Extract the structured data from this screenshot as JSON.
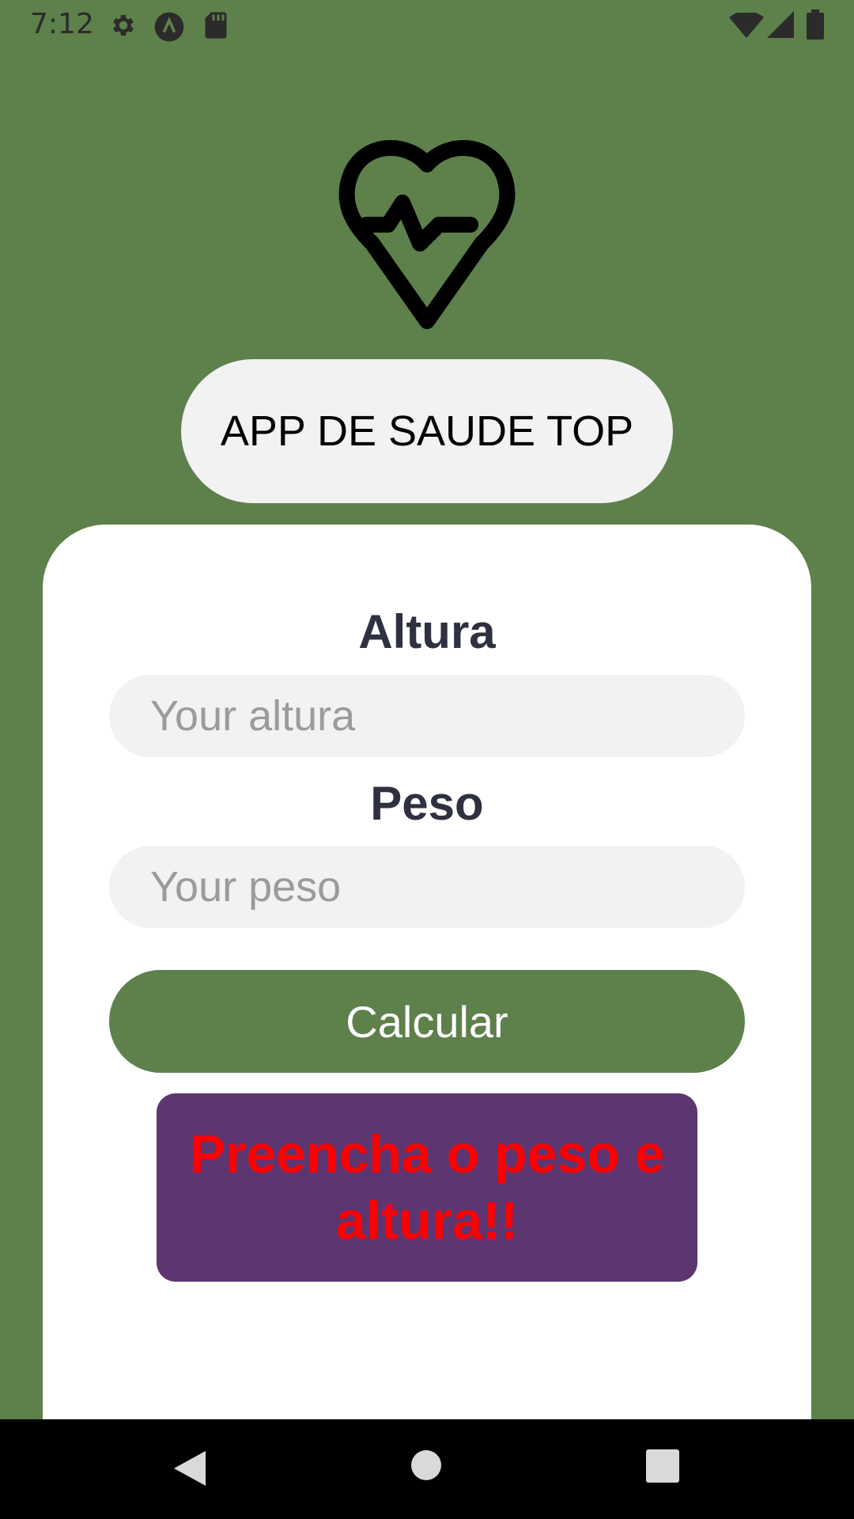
{
  "status_bar": {
    "time": "7:12",
    "left_icons": [
      "gear-icon",
      "app-a-icon",
      "sd-card-icon"
    ],
    "right_icons": [
      "wifi-icon",
      "signal-icon",
      "battery-icon"
    ]
  },
  "header": {
    "logo_icon": "heart-pulse-icon",
    "title": "APP DE SAUDE TOP"
  },
  "form": {
    "height_label": "Altura",
    "height_placeholder": "Your altura",
    "weight_label": "Peso",
    "weight_placeholder": "Your peso",
    "calculate_label": "Calcular",
    "message": "Preencha o peso e altura!!"
  },
  "nav_bar": {
    "icons": [
      "back-icon",
      "home-icon",
      "recents-icon"
    ]
  },
  "colors": {
    "background": "#5e804b",
    "button": "#5e804b",
    "message_box": "#5d3570",
    "message_text": "#ff0000"
  }
}
